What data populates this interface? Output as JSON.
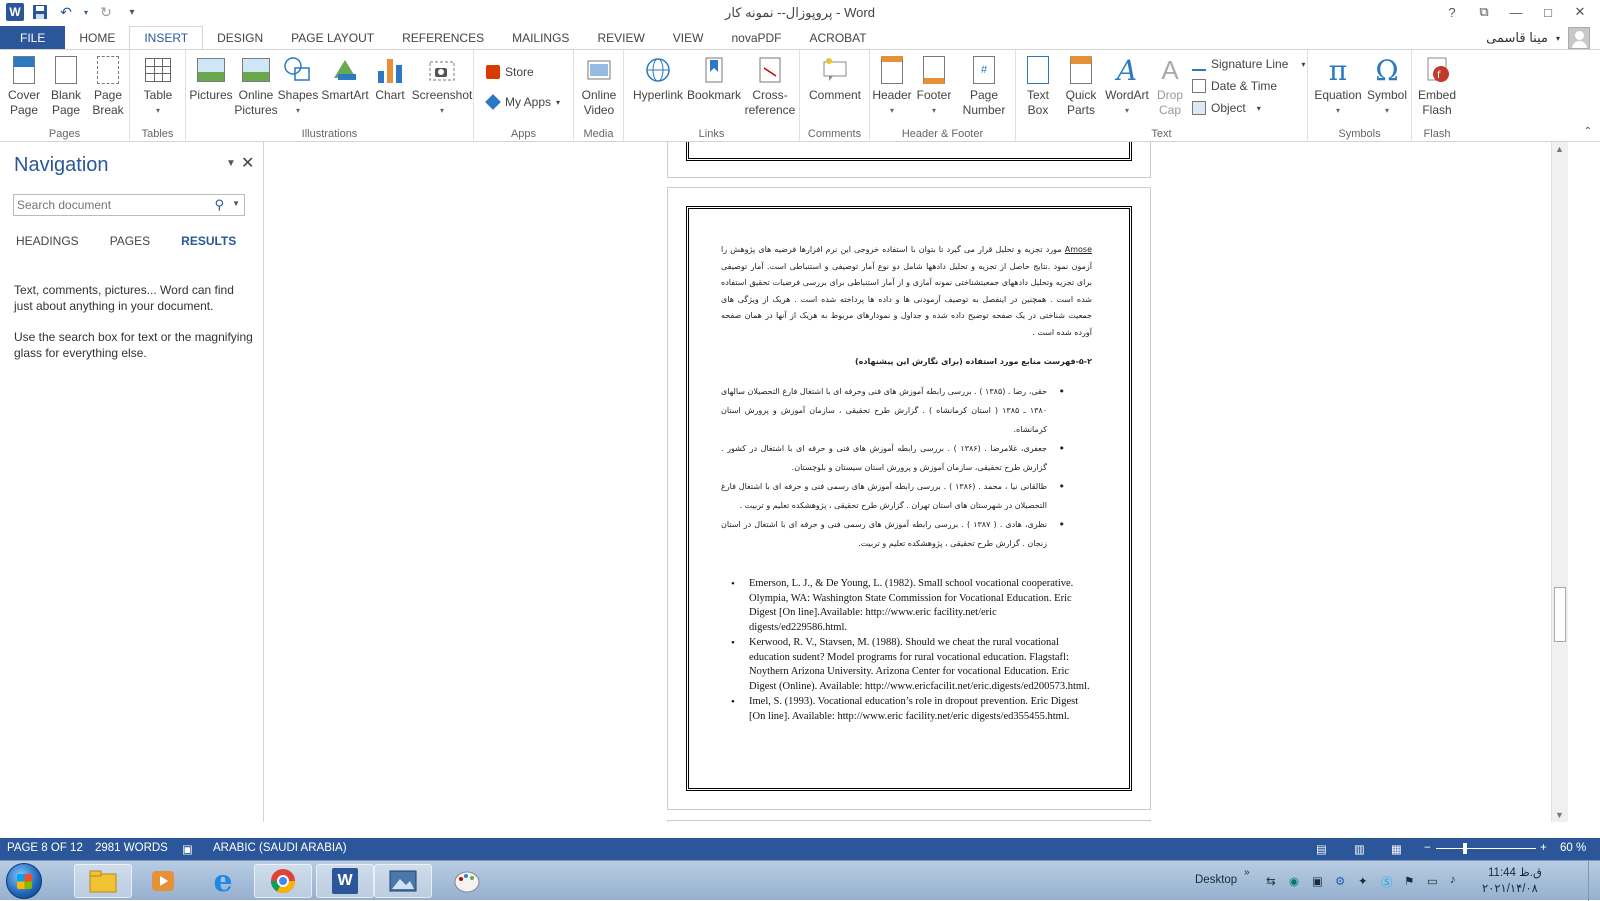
{
  "window": {
    "title": "پروپوزال-- نمونه کار - Word",
    "help": "?",
    "restore_ribbon": "⧉",
    "minimize": "—",
    "maximize": "□",
    "close": "✕"
  },
  "qat": {
    "customize": "⋯"
  },
  "tabs": [
    "FILE",
    "HOME",
    "INSERT",
    "DESIGN",
    "PAGE LAYOUT",
    "REFERENCES",
    "MAILINGS",
    "REVIEW",
    "VIEW",
    "novaPDF",
    "ACROBAT"
  ],
  "active_tab": "INSERT",
  "user": {
    "name": "مینا قاسمی"
  },
  "ribbon": {
    "groups": {
      "pages": "Pages",
      "tables": "Tables",
      "illustrations": "Illustrations",
      "apps": "Apps",
      "media": "Media",
      "links": "Links",
      "comments": "Comments",
      "header_footer": "Header & Footer",
      "text": "Text",
      "symbols": "Symbols",
      "flash": "Flash"
    },
    "buttons": {
      "cover_page_1": "Cover",
      "cover_page_2": "Page",
      "blank_page_1": "Blank",
      "blank_page_2": "Page",
      "page_break_1": "Page",
      "page_break_2": "Break",
      "table": "Table",
      "pictures": "Pictures",
      "online_pictures_1": "Online",
      "online_pictures_2": "Pictures",
      "shapes": "Shapes",
      "smartart": "SmartArt",
      "chart": "Chart",
      "screenshot": "Screenshot",
      "store": "Store",
      "my_apps": "My Apps",
      "online_video_1": "Online",
      "online_video_2": "Video",
      "hyperlink": "Hyperlink",
      "bookmark": "Bookmark",
      "cross_ref_1": "Cross-",
      "cross_ref_2": "reference",
      "comment": "Comment",
      "header": "Header",
      "footer": "Footer",
      "page_number_1": "Page",
      "page_number_2": "Number",
      "text_box_1": "Text",
      "text_box_2": "Box",
      "quick_parts_1": "Quick",
      "quick_parts_2": "Parts",
      "wordart": "WordArt",
      "drop_cap_1": "Drop",
      "drop_cap_2": "Cap",
      "signature_line": "Signature Line",
      "date_time": "Date & Time",
      "object": "Object",
      "equation": "Equation",
      "symbol": "Symbol",
      "embed_flash_1": "Embed",
      "embed_flash_2": "Flash"
    }
  },
  "navigation": {
    "title": "Navigation",
    "search_placeholder": "Search document",
    "tabs": [
      "HEADINGS",
      "PAGES",
      "RESULTS"
    ],
    "active_tab": "RESULTS",
    "msg1": "Text, comments, pictures... Word can find just about anything in your document.",
    "msg2": "Use the search box for text or the magnifying glass for everything else."
  },
  "document": {
    "para_lead": "Amose",
    "para": " مورد تجزیه و تحلیل قرار می گیرد تا بتوان با استفاده خروجی این نرم افزارها فرضیه های پژوهش را آزمون نمود .نتایج حاصل از تجزیه و تحلیل دادهها شامل دو نوع آمار توصیفی و استنباطی است. آمار توصیفی برای تجزیه وتحلیل دادههای جمعیتشناختی نمونه آماری و از آمار استنباطی برای بررسی فرضیات تحقیق استفاده شده است . همچنین در اینفصل به توصیف آزمودنی ها و داده ها پرداخته شده است . هریک از ویژگی های جمعیت شناختی در یک صفحه توضیح داده شده و جداول و نمودارهای مربوط به هریک از آنها در همان صفحه آورده شده است .",
    "heading": "۵-۲-فهرست منابع مورد استفاده (برای نگارش این پیشنهاده)",
    "fa_refs": [
      "حقی، رضا . (۱۳۸۵ ) . بررسی رابطه آموزش های فنی وحرفه ای با اشتغال فارغ التحصیلان سالهای ۱۳۸۰ ـ ۱۳۸۵ ( استان کرمانشاه ) . گزارش طرح تحقیقی ، سازمان آموزش و پرورش استان کرمانشاه.",
      "جعفری، غلامرضا . (۱۳۸۶ ) . بررسی رابطه آموزش های فنی و حرفه ای با اشتغال در کشور . گزارش طرح تحقیقی، سازمان آموزش و پرورش استان سیستان و بلوچستان.",
      "طالقانی نیا ، محمد . (۱۳۸۶ ) . بررسی رابطه آموزش های رسمی فنی و حرفه ای با اشتغال فارغ التحصیلان در شهرستان های استان تهران . گزارش طرح تحقیقی ، پژوهشکده تعلیم و تربیت .",
      "نظری، هادی . ( ۱۳۸۷ ) . بررسی رابطه آموزش های رسمی فنی و حرفه ای با اشتغال در استان زنجان . گزارش طرح تحقیقی ، پژوهشکده تعلیم و تربیت."
    ],
    "en_refs": [
      "Emerson, L. J., & De Young, L. (1982). Small school vocational cooperative. Olympia, WA: Washington State Commission for Vocational Education. Eric Digest [On line].Available: http://www.eric facility.net/eric digests/ed229586.html.",
      "Kerwood, R. V., Stavsen, M. (1988). Should we cheat the rural vocational education sudent? Model programs for rural vocational education. Flagstafl: Noythern Arizona University. Arizona Center for vocational Education. Eric Digest (Online). Available: http://www.ericfacilit.net/eric.digests/ed200573.html.",
      "Imel, S. (1993). Vocational education’s role in dropout prevention. Eric Digest [On line]. Available: http://www.eric facility.net/eric digests/ed355455.html."
    ]
  },
  "status": {
    "page": "PAGE 8 OF 12",
    "words": "2981 WORDS",
    "language": "ARABIC (SAUDI ARABIA)",
    "zoom": "60 %",
    "zoom_minus": "−",
    "zoom_plus": "+"
  },
  "taskbar": {
    "desktop": "Desktop",
    "time": "11:44 ق.ظ",
    "date": "۲۰۲۱/۱۴/۰۸"
  },
  "colors": {
    "accent": "#2b579a",
    "taskbar": "#a6bed9"
  }
}
